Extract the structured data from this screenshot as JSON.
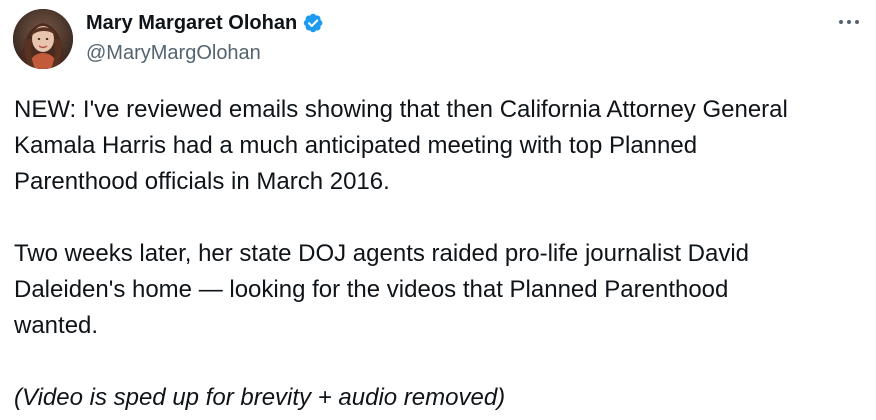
{
  "author": {
    "display_name": "Mary Margaret Olohan",
    "handle": "@MaryMargOlohan",
    "verified_badge_icon": "verified-badge-icon",
    "avatar_icon": "profile-photo"
  },
  "actions": {
    "more_icon": "more-options-icon"
  },
  "tweet": {
    "paragraph_1": "NEW: I've reviewed emails showing that then California Attorney General\nKamala Harris had a much anticipated meeting with top Planned\nParenthood officials in March 2016.",
    "paragraph_2": "Two weeks later, her state DOJ agents raided pro-life journalist David\nDaleiden's home — looking for the videos that Planned Parenthood\nwanted.",
    "paragraph_3": "(Video is sped up for brevity + audio removed)"
  },
  "colors": {
    "text": "#0f1419",
    "secondary_text": "#536471",
    "verified_blue": "#1d9bf0",
    "background": "#ffffff"
  }
}
